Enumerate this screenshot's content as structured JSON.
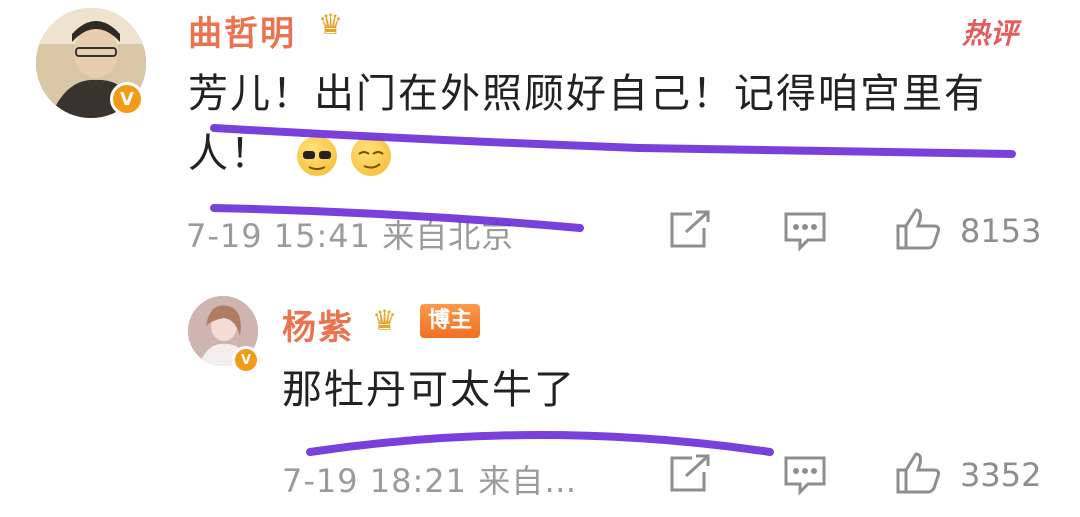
{
  "comments": [
    {
      "username": "曲哲明",
      "tag": "热评",
      "text_line1": "芳儿！出门在外照顾好自己！记得咱宫里有",
      "text_line2": "人！",
      "emoji_1": "sunglasses-emoji",
      "emoji_2": "smirk-emoji",
      "timestamp": "7-19 15:41 来自北京",
      "likes": "8153"
    },
    {
      "username": "杨紫",
      "badge": "博主",
      "text": "那牡丹可太牛了",
      "timestamp": "7-19 18:21 来自…",
      "likes": "3352"
    }
  ],
  "icons": {
    "verified": "V",
    "crown": "♛"
  },
  "colors": {
    "username": "#eb7350",
    "highlight_stroke": "#6a2bd8",
    "meta": "#9b9b9b"
  }
}
